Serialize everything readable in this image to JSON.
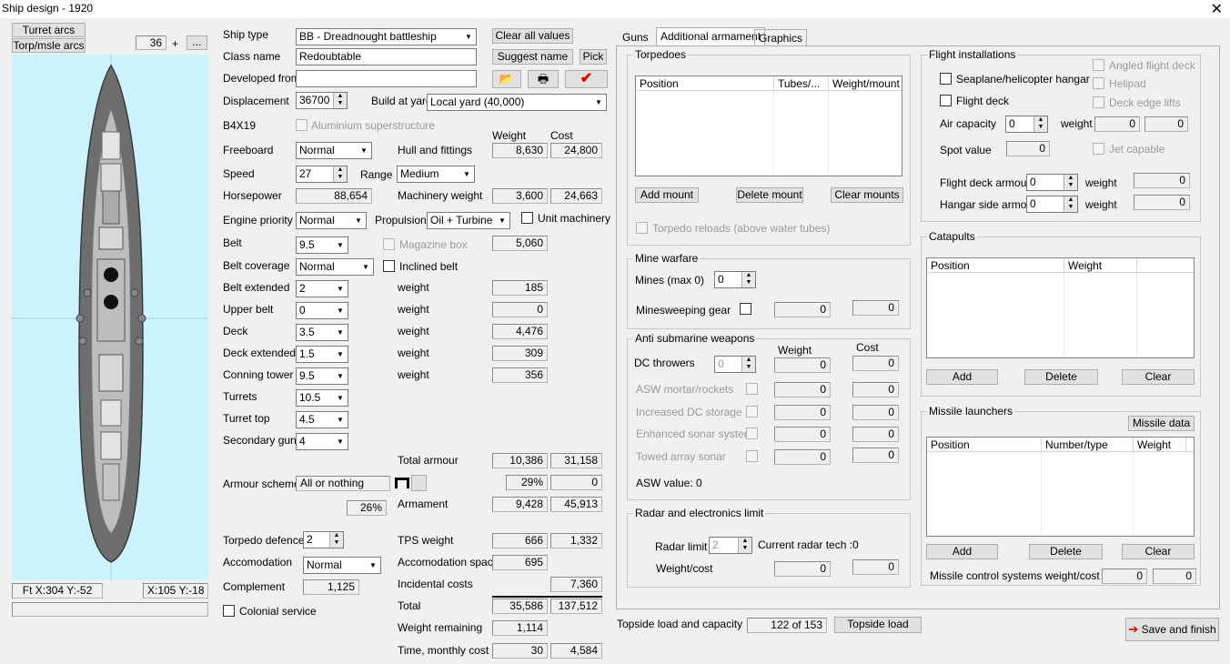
{
  "window": {
    "title": "Ship design - 1920"
  },
  "left": {
    "turret_arcs": "Turret arcs",
    "torp_arcs": "Torp/msle arcs",
    "zoom": "36",
    "zoom_plus": "+",
    "zoom_btn": "...",
    "coord_left": "Ft X:304 Y:-52",
    "coord_right": "X:105 Y:-18"
  },
  "form": {
    "ship_type_label": "Ship type",
    "ship_type_value": "BB - Dreadnought battleship",
    "clear_all": "Clear all values",
    "class_name_label": "Class name",
    "class_name_value": "Redoubtable",
    "suggest_name": "Suggest name",
    "pick": "Pick",
    "developed_from_label": "Developed from",
    "developed_from_value": "",
    "displacement_label": "Displacement",
    "displacement_value": "36700",
    "build_at_yard_label": "Build at yard",
    "build_at_yard_value": "Local yard (40,000)",
    "code": "B4X19",
    "aluminium": "Aluminium superstructure",
    "weight_hdr": "Weight",
    "cost_hdr": "Cost",
    "freeboard_label": "Freeboard",
    "freeboard_value": "Normal",
    "hull_label": "Hull and fittings",
    "hull_weight": "8,630",
    "hull_cost": "24,800",
    "speed_label": "Speed",
    "speed_value": "27",
    "range_label": "Range",
    "range_value": "Medium",
    "horsepower_label": "Horsepower",
    "horsepower_value": "88,654",
    "machinery_label": "Machinery weight",
    "machinery_weight": "3,600",
    "machinery_cost": "24,663",
    "engine_priority_label": "Engine priority",
    "engine_priority_value": "Normal",
    "propulsion_label": "Propulsion",
    "propulsion_value": "Oil + Turbine",
    "unit_machinery": "Unit machinery",
    "belt_label": "Belt",
    "belt_value": "9.5",
    "magazine_box": "Magazine box",
    "magazine_weight": "5,060",
    "belt_coverage_label": "Belt coverage",
    "belt_coverage_value": "Normal",
    "inclined_belt": "Inclined belt",
    "belt_extended_label": "Belt extended",
    "belt_extended_value": "2",
    "belt_extended_weight": "185",
    "upper_belt_label": "Upper belt",
    "upper_belt_value": "0",
    "upper_belt_weight": "0",
    "deck_label": "Deck",
    "deck_value": "3.5",
    "deck_weight": "4,476",
    "deck_extended_label": "Deck extended",
    "deck_extended_value": "1.5",
    "deck_extended_weight": "309",
    "conning_tower_label": "Conning tower",
    "conning_tower_value": "9.5",
    "conning_tower_weight": "356",
    "weight_word": "weight",
    "turrets_label": "Turrets",
    "turrets_value": "10.5",
    "turret_top_label": "Turret top",
    "turret_top_value": "4.5",
    "secondary_label": "Secondary guns",
    "secondary_value": "4",
    "total_armour_label": "Total armour",
    "total_armour_weight": "10,386",
    "total_armour_cost": "31,158",
    "armour_scheme_label": "Armour scheme",
    "armour_scheme_value": "All or nothing",
    "armour_pct": "29%",
    "armour_zero": "0",
    "pct_26": "26%",
    "armament_label": "Armament",
    "armament_weight": "9,428",
    "armament_cost": "45,913",
    "torpedo_defence_label": "Torpedo defence",
    "torpedo_defence_value": "2",
    "tps_label": "TPS weight",
    "tps_weight": "666",
    "tps_cost": "1,332",
    "accomodation_label": "Accomodation",
    "accomodation_value": "Normal",
    "accom_space_label": "Accomodation space",
    "accom_space_value": "695",
    "complement_label": "Complement",
    "complement_value": "1,125",
    "incidental_label": "Incidental costs",
    "incidental_value": "7,360",
    "colonial": "Colonial service",
    "total_label": "Total",
    "total_weight": "35,586",
    "total_cost": "137,512",
    "weight_remaining_label": "Weight remaining",
    "weight_remaining_value": "1,114",
    "time_label": "Time, monthly cost",
    "time_value": "30",
    "monthly_value": "4,584"
  },
  "tabs": {
    "guns": "Guns",
    "additional": "Additional armament",
    "graphics": "Graphics"
  },
  "torpedoes": {
    "title": "Torpedoes",
    "col_position": "Position",
    "col_tubes": "Tubes/...",
    "col_weight": "Weight/mount",
    "add": "Add mount",
    "delete": "Delete mount",
    "clear": "Clear mounts",
    "reloads": "Torpedo reloads (above water tubes)"
  },
  "mines": {
    "title": "Mine warfare",
    "mines_label": "Mines (max 0)",
    "mines_value": "0",
    "sweeping_label": "Minesweeping gear",
    "sweeping_w": "0",
    "sweeping_c": "0"
  },
  "asw": {
    "title": "Anti submarine weapons",
    "weight_hdr": "Weight",
    "cost_hdr": "Cost",
    "dc_label": "DC throwers",
    "dc_value": "0",
    "dc_w": "0",
    "dc_c": "0",
    "mortar": "ASW mortar/rockets",
    "mortar_w": "0",
    "mortar_c": "0",
    "increased": "Increased DC storage",
    "increased_w": "0",
    "increased_c": "0",
    "sonar": "Enhanced sonar system",
    "sonar_w": "0",
    "sonar_c": "0",
    "towed": "Towed array sonar",
    "towed_w": "0",
    "towed_c": "0",
    "value": "ASW value: 0"
  },
  "radar": {
    "title": "Radar and electronics limit",
    "limit_label": "Radar limit",
    "limit_value": "2",
    "tech": "Current radar tech :0",
    "wc_label": "Weight/cost",
    "w": "0",
    "c": "0"
  },
  "flight": {
    "title": "Flight installations",
    "seaplane": "Seaplane/helicopter hangar",
    "flight_deck": "Flight deck",
    "angled": "Angled flight deck",
    "helipad": "Helipad",
    "edge_lifts": "Deck edge lifts",
    "air_capacity_label": "Air capacity",
    "air_capacity_value": "0",
    "weight_word": "weight",
    "air_w": "0",
    "air_c": "0",
    "spot_label": "Spot value",
    "spot_value": "0",
    "jet": "Jet capable",
    "fd_armour_label": "Flight deck armour",
    "fd_armour_value": "0",
    "fd_armour_w": "0",
    "hangar_label": "Hangar side armour",
    "hangar_value": "0",
    "hangar_w": "0"
  },
  "catapults": {
    "title": "Catapults",
    "col_position": "Position",
    "col_weight": "Weight",
    "add": "Add",
    "delete": "Delete",
    "clear": "Clear"
  },
  "missiles": {
    "title": "Missile launchers",
    "data_btn": "Missile data",
    "col_position": "Position",
    "col_number": "Number/type",
    "col_weight": "Weight",
    "add": "Add",
    "delete": "Delete",
    "clear": "Clear",
    "control_label": "Missile control systems weight/cost",
    "control_w": "0",
    "control_c": "0"
  },
  "bottom": {
    "topside_label": "Topside load and capacity",
    "topside_value": "122 of 153",
    "topside_btn": "Topside load",
    "save": "Save and finish"
  },
  "colors": {
    "sea": "#ccf3ff",
    "hull": "#6e6e6e",
    "deck": "#bdbdbd",
    "save_arrow": "#e00000",
    "check_red": "#e00000"
  }
}
